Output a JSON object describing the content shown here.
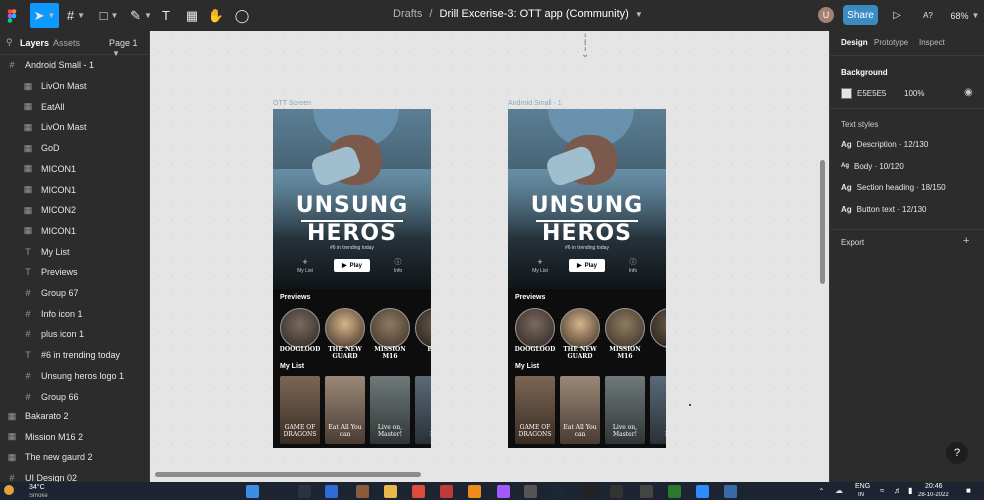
{
  "toolbar": {
    "breadcrumb_drafts": "Drafts",
    "separator": "/",
    "file_name": "Drill Excerise-3: OTT app (Community)",
    "avatar_initial": "U",
    "share_label": "Share",
    "text_tool": "T",
    "font_tool": "A?",
    "zoom": "68%"
  },
  "left_panel": {
    "tab_layers": "Layers",
    "tab_assets": "Assets",
    "page": "Page 1",
    "root_frame": "Android Small - 1",
    "layers": [
      {
        "icon": "image-icon",
        "label": "LivOn Mast"
      },
      {
        "icon": "image-icon",
        "label": "EatAll"
      },
      {
        "icon": "image-icon",
        "label": "LivOn Mast"
      },
      {
        "icon": "image-icon",
        "label": "GoD"
      },
      {
        "icon": "image-icon",
        "label": "MICON1"
      },
      {
        "icon": "image-icon",
        "label": "MICON1"
      },
      {
        "icon": "image-icon",
        "label": "MICON2"
      },
      {
        "icon": "image-icon",
        "label": "MICON1"
      },
      {
        "icon": "text-icon",
        "label": "My List"
      },
      {
        "icon": "text-icon",
        "label": "Previews"
      },
      {
        "icon": "frame-icon",
        "label": "Group 67"
      },
      {
        "icon": "frame-icon",
        "label": "Info icon 1"
      },
      {
        "icon": "frame-icon",
        "label": "plus icon 1"
      },
      {
        "icon": "text-icon",
        "label": "#6 in trending today"
      },
      {
        "icon": "frame-icon",
        "label": "Unsung heros logo 1"
      },
      {
        "icon": "frame-icon",
        "label": "Group 66"
      }
    ],
    "top_layers": [
      {
        "icon": "image-icon",
        "label": "Bakarato 2"
      },
      {
        "icon": "image-icon",
        "label": "Mission M16 2"
      },
      {
        "icon": "image-icon",
        "label": "The new gaurd 2"
      },
      {
        "icon": "frame-icon",
        "label": "UI Design 02"
      }
    ]
  },
  "canvas": {
    "frames": [
      {
        "label": "OTT Screen",
        "title_line1": "UNSUNG",
        "title_line2": "HEROS",
        "trending": "#6 in trending today",
        "my_list_label": "My List",
        "play_label": "Play",
        "info_label": "Info",
        "previews_heading": "Previews",
        "mylist_heading": "My List",
        "previews": [
          "DOOGLOOD",
          "THE NEW GUARD",
          "MISSION M16",
          "BAN"
        ],
        "posters": [
          "GAME OF DRAGONS",
          "Eat All You can",
          "Live on, Master!",
          "Inb"
        ]
      },
      {
        "label": "Android Small - 1",
        "title_line1": "UNSUNG",
        "title_line2": "HEROS",
        "trending": "#6 in trending today",
        "my_list_label": "My List",
        "play_label": "Play",
        "info_label": "Info",
        "previews_heading": "Previews",
        "mylist_heading": "My List",
        "previews": [
          "DOOGLOOD",
          "THE NEW GUARD",
          "MISSION M16",
          "BA"
        ],
        "posters": [
          "GAME OF DRAGONS",
          "Eat All You can",
          "Live on, Master!",
          "Inb"
        ]
      }
    ]
  },
  "right_panel": {
    "tabs": [
      "Design",
      "Prototype",
      "Inspect"
    ],
    "background_heading": "Background",
    "bg_hex": "E5E5E5",
    "bg_opacity": "100%",
    "text_styles_heading": "Text styles",
    "text_styles": [
      {
        "ag": "Ag",
        "label": "Description · 12/130"
      },
      {
        "ag": "Ag",
        "label": "Body · 10/120"
      },
      {
        "ag": "Ag",
        "label": "Section heading · 18/150"
      },
      {
        "ag": "Ag",
        "label": "Button text · 12/130"
      }
    ],
    "export_label": "Export",
    "help": "?"
  },
  "taskbar": {
    "temp": "34°C",
    "weather": "Smoke",
    "lang": "ENG",
    "region": "IN",
    "time": "20:46",
    "date": "28-10-2022"
  },
  "colors": {
    "accent": "#0d99ff",
    "share": "#3b8ac4",
    "panel": "#2c2c2c",
    "canvas": "#e5e5e5"
  }
}
